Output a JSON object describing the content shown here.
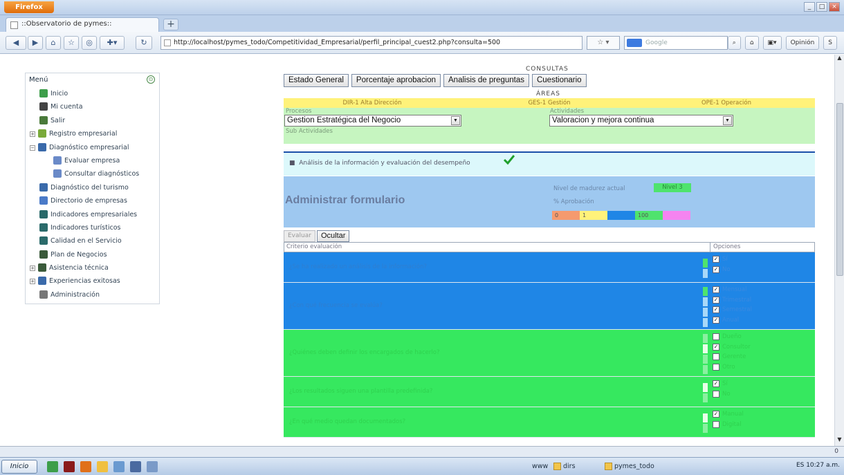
{
  "browser": {
    "button_label": "Firefox",
    "tab_title": "::Observatorio de pymes::",
    "url": "http://localhost/pymes_todo/Competitividad_Empresarial/perfil_principal_cuest2.php?consulta=500",
    "search_placeholder": "Google",
    "opinion_label": "Opinión"
  },
  "menu": {
    "title": "Menú",
    "items": [
      {
        "label": "Inicio"
      },
      {
        "label": "Mi cuenta"
      },
      {
        "label": "Salir"
      },
      {
        "label": "Registro empresarial"
      },
      {
        "label": "Diagnóstico empresarial"
      },
      {
        "label": "Evaluar empresa"
      },
      {
        "label": "Consultar diagnósticos"
      },
      {
        "label": "Diagnóstico del turismo"
      },
      {
        "label": "Directorio de empresas"
      },
      {
        "label": "Indicadores empresariales"
      },
      {
        "label": "Indicadores turísticos"
      },
      {
        "label": "Calidad en el Servicio"
      },
      {
        "label": "Plan de Negocios"
      },
      {
        "label": "Asistencia técnica"
      },
      {
        "label": "Experiencias exitosas"
      },
      {
        "label": "Administración"
      }
    ]
  },
  "consultas": {
    "title": "CONSULTAS",
    "tabs": [
      "Estado General",
      "Porcentaje aprobacion",
      "Analisis de preguntas",
      "Cuestionario"
    ],
    "areas_title": "ÁREAS",
    "areas": [
      "DIR-1 Alta Dirección",
      "GES-1 Gestión",
      "OPE-1 Operación"
    ]
  },
  "filters": {
    "procesos_label": "Procesos",
    "procesos_value": "Gestion Estratégica del Negocio",
    "actividades_label": "Actividades",
    "actividades_value": "Valoracion y mejora continua",
    "subactividades_label": "Sub Actividades",
    "subactividad_item": "Análisis de la información y evaluación del desempeño"
  },
  "admin": {
    "title": "Administrar formulario",
    "nivel_label": "Nivel de madurez actual",
    "nivel_value": "Nivel 3",
    "aprobacion_label": "% Aprobación",
    "scale": [
      {
        "label": "0",
        "color": "#f59a6e"
      },
      {
        "label": "1",
        "color": "#fff27a"
      },
      {
        "label": "",
        "color": "#1f86e6"
      },
      {
        "label": "100",
        "color": "#4fe36d"
      },
      {
        "label": "",
        "color": "#f584f0"
      }
    ]
  },
  "buttons": {
    "evaluar": "Evaluar",
    "ocultar": "Ocultar"
  },
  "table": {
    "col_criterio": "Criterio evaluación",
    "col_opciones": "Opciones",
    "rows": [
      {
        "question": "¿Se ha realizado un análisis de la información?",
        "color": "#1f86e6",
        "options": [
          {
            "label": "Sí",
            "checked": true
          },
          {
            "label": "No",
            "checked": true
          }
        ]
      },
      {
        "question": "¿Con qué frecuencia se evalúa?",
        "color": "#1f86e6",
        "options": [
          {
            "label": "Mensual",
            "checked": true
          },
          {
            "label": "Trimestral",
            "checked": true
          },
          {
            "label": "Semestral",
            "checked": true
          },
          {
            "label": "Anual",
            "checked": true
          }
        ]
      },
      {
        "question": "¿Quiénes deben definir los encargados de hacerlo?",
        "color": "#36e85f",
        "options": [
          {
            "label": "Dueño",
            "checked": false
          },
          {
            "label": "Consultor",
            "checked": true
          },
          {
            "label": "Gerente",
            "checked": false
          },
          {
            "label": "Otro",
            "checked": false
          }
        ]
      },
      {
        "question": "¿Los resultados siguen una plantilla predefinida?",
        "color": "#36e85f",
        "options": [
          {
            "label": "Sí",
            "checked": true
          },
          {
            "label": "No",
            "checked": false
          }
        ]
      },
      {
        "question": "¿En qué medio quedan documentados?",
        "color": "#36e85f",
        "options": [
          {
            "label": "Manual",
            "checked": true
          },
          {
            "label": "Digital",
            "checked": false
          }
        ]
      }
    ]
  },
  "status": {
    "left": "",
    "right": "0"
  },
  "taskbar": {
    "start": "Inicio",
    "tasks": [
      "www",
      "dirs",
      "pymes_todo"
    ],
    "tray": "ES  10:27 a.m."
  }
}
